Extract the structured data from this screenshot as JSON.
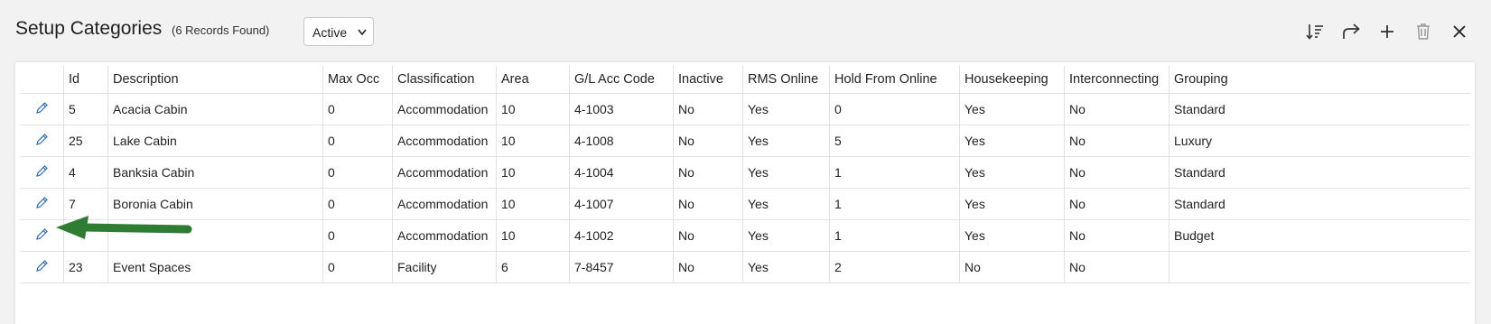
{
  "header": {
    "title": "Setup Categories",
    "record_count": "(6 Records Found)",
    "status_filter": "Active"
  },
  "toolbar": {
    "icons": [
      "sort-icon",
      "share-icon",
      "add-icon",
      "delete-icon",
      "close-icon"
    ]
  },
  "table": {
    "columns": [
      "Id",
      "Description",
      "Max Occ",
      "Classification",
      "Area",
      "G/L Acc Code",
      "Inactive",
      "RMS Online",
      "Hold From Online",
      "Housekeeping",
      "Interconnecting",
      "Grouping"
    ],
    "rows": [
      [
        "5",
        "Acacia Cabin",
        "0",
        "Accommodation",
        "10",
        "4-1003",
        "No",
        "Yes",
        "0",
        "Yes",
        "No",
        "Standard"
      ],
      [
        "25",
        "Lake Cabin",
        "0",
        "Accommodation",
        "10",
        "4-1008",
        "No",
        "Yes",
        "5",
        "Yes",
        "No",
        "Luxury"
      ],
      [
        "4",
        "Banksia Cabin",
        "0",
        "Accommodation",
        "10",
        "4-1004",
        "No",
        "Yes",
        "1",
        "Yes",
        "No",
        "Standard"
      ],
      [
        "7",
        "Boronia Cabin",
        "0",
        "Accommodation",
        "10",
        "4-1007",
        "No",
        "Yes",
        "1",
        "Yes",
        "No",
        "Standard"
      ],
      [
        "",
        "",
        "0",
        "Accommodation",
        "10",
        "4-1002",
        "No",
        "Yes",
        "1",
        "Yes",
        "No",
        "Budget"
      ],
      [
        "23",
        "Event Spaces",
        "0",
        "Facility",
        "6",
        "7-8457",
        "No",
        "Yes",
        "2",
        "No",
        "No",
        ""
      ]
    ]
  },
  "colors": {
    "accent_blue": "#2f6db5",
    "annotation_arrow": "#2e7d32",
    "page_background": "#f2f2f2"
  }
}
